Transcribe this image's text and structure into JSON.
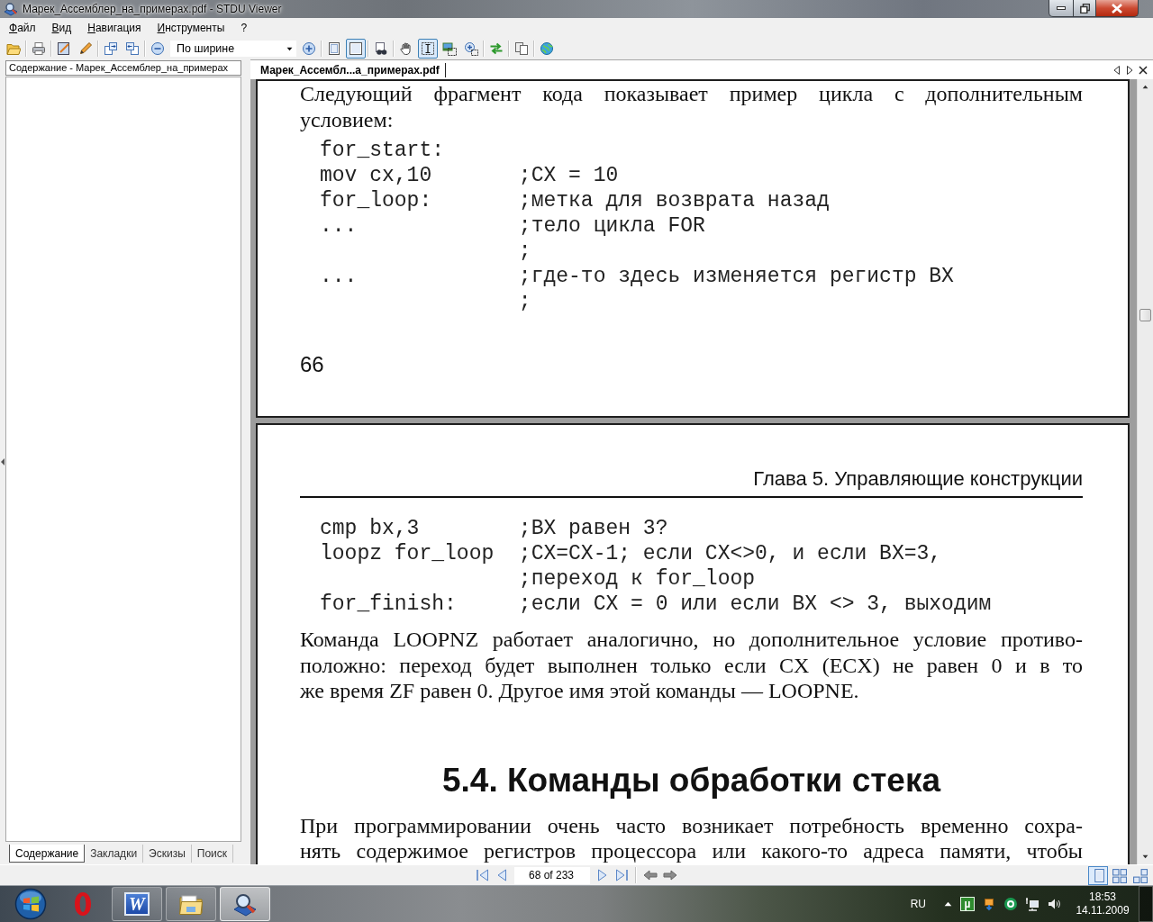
{
  "window": {
    "title": "Марек_Ассемблер_на_примерах.pdf - STDU Viewer"
  },
  "menu": [
    "Файл",
    "Вид",
    "Навигация",
    "Инструменты",
    "?"
  ],
  "toolbar": {
    "groups": [
      [
        {
          "kind": "open",
          "pressed": false
        }
      ],
      [
        {
          "kind": "print",
          "pressed": false
        }
      ],
      [
        {
          "kind": "edit_page",
          "pressed": false
        },
        {
          "kind": "pencil",
          "pressed": false
        }
      ],
      [
        {
          "kind": "page_export",
          "pressed": false
        },
        {
          "kind": "page_import",
          "pressed": false
        }
      ],
      [
        {
          "kind": "zoom_out",
          "pressed": false
        },
        {
          "kind": "zoom_mode",
          "value": "По ширине"
        },
        {
          "kind": "zoom_in",
          "pressed": false
        }
      ],
      [
        {
          "kind": "actual_size",
          "pressed": false
        },
        {
          "kind": "fit_page",
          "pressed": true
        }
      ],
      [
        {
          "kind": "find",
          "pressed": false
        }
      ],
      [
        {
          "kind": "hand",
          "pressed": false
        },
        {
          "kind": "text_select",
          "pressed": true
        },
        {
          "kind": "image_select",
          "pressed": false
        },
        {
          "kind": "zoom_area",
          "pressed": false
        }
      ],
      [
        {
          "kind": "sync",
          "pressed": false
        }
      ],
      [
        {
          "kind": "copy",
          "pressed": false
        }
      ],
      [
        {
          "kind": "update",
          "pressed": false
        }
      ]
    ]
  },
  "sidebar": {
    "title": "Содержание - Марек_Ассемблер_на_примерах",
    "tabs": [
      {
        "label": "Содержание",
        "selected": true
      },
      {
        "label": "Закладки",
        "selected": false
      },
      {
        "label": "Эскизы",
        "selected": false
      },
      {
        "label": "Поиск",
        "selected": false
      }
    ]
  },
  "document": {
    "tab": "Марек_Ассембл...а_примерах.pdf",
    "pages": [
      {
        "blocks": [
          {
            "kind": "paragraph",
            "lines": [
              "Следующий фрагмент кода показывает пример цикла с дополнительным",
              "условием:"
            ]
          },
          {
            "kind": "code",
            "rows": [
              {
                "code": "for_start:"
              },
              {
                "code": "mov cx,10",
                "comment": ";CX = 10"
              },
              {
                "code": "for_loop:",
                "comment": ";метка для возврата назад"
              },
              {
                "code": "...",
                "comment": ";тело цикла FOR"
              },
              {
                "comment": ";"
              },
              {
                "code": "...",
                "comment": ";где-то здесь изменяется регистр BX"
              },
              {
                "comment": ";"
              }
            ]
          },
          {
            "kind": "page_number",
            "text": "66"
          }
        ]
      },
      {
        "blocks": [
          {
            "kind": "running_head",
            "text": "Глава 5. Управляющие конструкции"
          },
          {
            "kind": "code",
            "rows": [
              {
                "code": "cmp bx,3",
                "comment": ";BX равен 3?"
              },
              {
                "code": "loopz for_loop",
                "comment": ";CX=CX-1; если CX<>0, и если BX=3,"
              },
              {
                "comment": ";переход к for_loop"
              },
              {
                "code": "for_finish:",
                "comment": ";если CX = 0 или если BX <> 3, выходим"
              }
            ]
          },
          {
            "kind": "paragraph",
            "continues": false,
            "lines": [
              "Команда LOOPNZ работает аналогично, но дополнительное условие противо-",
              "положно: переход будет выполнен только если CX (ECX) не равен 0 и в то",
              "же время ZF равен 0. Другое имя этой команды — LOOPNE."
            ]
          },
          {
            "kind": "heading",
            "text": "5.4. Команды обработки стека"
          },
          {
            "kind": "paragraph",
            "continues": true,
            "lines": [
              "При программировании очень часто возникает потребность временно сохра-",
              "нять содержимое регистров процессора или какого-то адреса памяти, чтобы"
            ]
          }
        ]
      }
    ]
  },
  "status_bar": {
    "page": "68 of 233",
    "view_modes": [
      {
        "kind": "single",
        "selected": true
      },
      {
        "kind": "grid",
        "selected": false
      },
      {
        "kind": "multi",
        "selected": false
      }
    ]
  },
  "taskbar": {
    "apps": [
      {
        "kind": "opera",
        "running": false,
        "selected": false
      },
      {
        "kind": "word",
        "glyph": "W",
        "running": true,
        "selected": false
      },
      {
        "kind": "explorer",
        "running": true,
        "selected": false
      },
      {
        "kind": "viewer",
        "running": true,
        "selected": true
      }
    ],
    "tray": {
      "language": "RU",
      "icons": [
        {
          "kind": "torrent",
          "glyph": "µ"
        },
        {
          "kind": "share"
        },
        {
          "kind": "ring"
        },
        {
          "kind": "network"
        },
        {
          "kind": "volume"
        }
      ],
      "time": "18:53",
      "date": "14.11.2009"
    }
  }
}
